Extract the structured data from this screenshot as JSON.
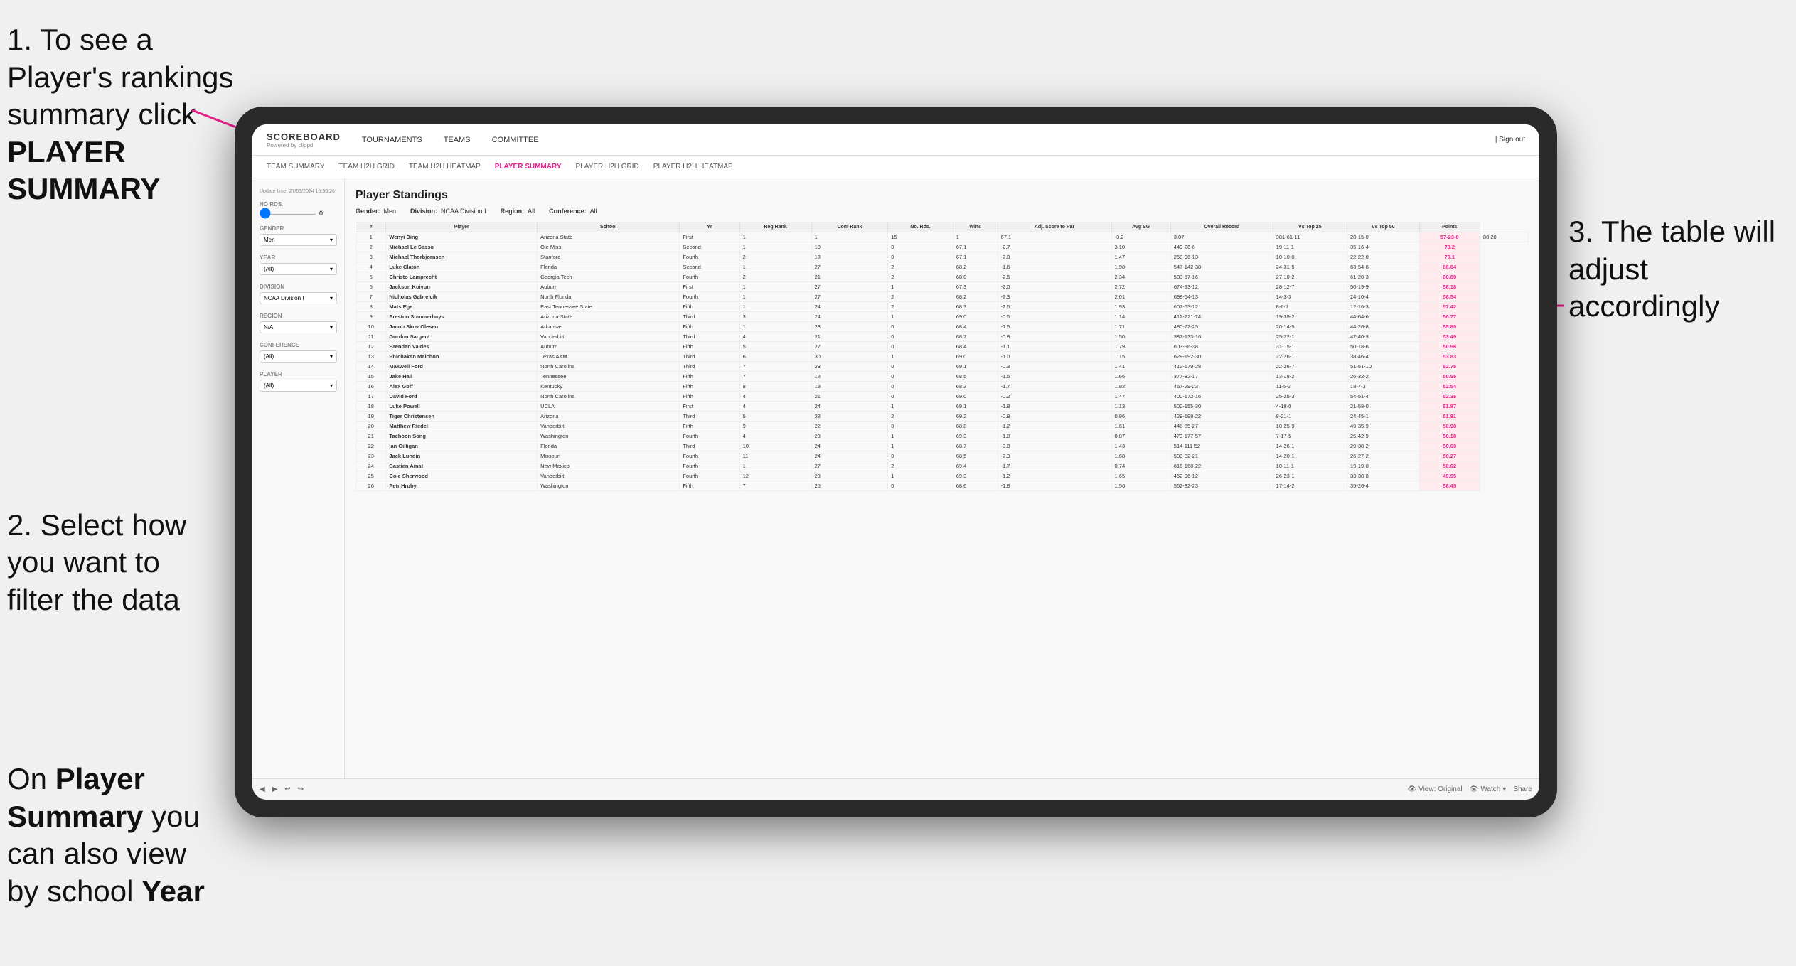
{
  "annotations": {
    "step1": "1. To see a Player's rankings summary click ",
    "step1_bold": "PLAYER SUMMARY",
    "step2_line1": "2. Select how",
    "step2_line2": "you want to",
    "step2_line3": "filter the data",
    "step3_left_line1": "On ",
    "step3_left_bold1": "Player",
    "step3_left_line2": "Summary",
    "step3_left_normal": " you",
    "step3_left_line3": "can also view",
    "step3_left_line4": "by school ",
    "step3_left_bold2": "Year",
    "step3_right_line1": "3. The table will",
    "step3_right_line2": "adjust accordingly"
  },
  "navbar": {
    "logo": "SCOREBOARD",
    "logo_sub": "Powered by clippd",
    "links": [
      "TOURNAMENTS",
      "TEAMS",
      "COMMITTEE"
    ],
    "right": [
      "| Sign out"
    ]
  },
  "sub_navbar": {
    "links": [
      "TEAM SUMMARY",
      "TEAM H2H GRID",
      "TEAM H2H HEATMAP",
      "PLAYER SUMMARY",
      "PLAYER H2H GRID",
      "PLAYER H2H HEATMAP"
    ]
  },
  "sidebar": {
    "update_time": "Update time: 27/03/2024 16:56:26",
    "no_rds_label": "No Rds.",
    "gender_label": "Gender",
    "gender_value": "Men",
    "year_label": "Year",
    "year_value": "(All)",
    "division_label": "Division",
    "division_value": "NCAA Division I",
    "region_label": "Region",
    "region_value": "N/A",
    "conference_label": "Conference",
    "conference_value": "(All)",
    "player_label": "Player",
    "player_value": "(All)"
  },
  "main": {
    "title": "Player Standings",
    "filters": {
      "gender_label": "Gender:",
      "gender_value": "Men",
      "division_label": "Division:",
      "division_value": "NCAA Division I",
      "region_label": "Region:",
      "region_value": "All",
      "conference_label": "Conference:",
      "conference_value": "All"
    },
    "table": {
      "headers": [
        "#",
        "Player",
        "School",
        "Yr",
        "Reg Rank",
        "Conf Rank",
        "No. Rds.",
        "Wins",
        "Adj. Score to Par",
        "Avg SG",
        "Overall Record",
        "Vs Top 25",
        "Vs Top 50",
        "Points"
      ],
      "rows": [
        [
          "1",
          "Wenyi Ding",
          "Arizona State",
          "First",
          "1",
          "1",
          "15",
          "1",
          "67.1",
          "-3.2",
          "3.07",
          "381-61-11",
          "28-15-0",
          "57-23-0",
          "88.20"
        ],
        [
          "2",
          "Michael Le Sasso",
          "Ole Miss",
          "Second",
          "1",
          "18",
          "0",
          "67.1",
          "-2.7",
          "3.10",
          "440-26-6",
          "19-11-1",
          "35-16-4",
          "78.2"
        ],
        [
          "3",
          "Michael Thorbjornsen",
          "Stanford",
          "Fourth",
          "2",
          "18",
          "0",
          "67.1",
          "-2.0",
          "1.47",
          "258-96-13",
          "10-10-0",
          "22-22-0",
          "70.1"
        ],
        [
          "4",
          "Luke Claton",
          "Florida",
          "Second",
          "1",
          "27",
          "2",
          "68.2",
          "-1.6",
          "1.98",
          "547-142-38",
          "24-31-5",
          "63-54-6",
          "66.04"
        ],
        [
          "5",
          "Christo Lamprecht",
          "Georgia Tech",
          "Fourth",
          "2",
          "21",
          "2",
          "68.0",
          "-2.5",
          "2.34",
          "533-57-16",
          "27-10-2",
          "61-20-3",
          "60.89"
        ],
        [
          "6",
          "Jackson Koivun",
          "Auburn",
          "First",
          "1",
          "27",
          "1",
          "67.3",
          "-2.0",
          "2.72",
          "674-33-12",
          "28-12-7",
          "50-19-9",
          "58.18"
        ],
        [
          "7",
          "Nicholas Gabrelcik",
          "North Florida",
          "Fourth",
          "1",
          "27",
          "2",
          "68.2",
          "-2.3",
          "2.01",
          "698-54-13",
          "14-3-3",
          "24-10-4",
          "58.54"
        ],
        [
          "8",
          "Mats Ege",
          "East Tennessee State",
          "Fifth",
          "1",
          "24",
          "2",
          "68.3",
          "-2.5",
          "1.93",
          "607-63-12",
          "8-6-1",
          "12-16-3",
          "57.42"
        ],
        [
          "9",
          "Preston Summerhays",
          "Arizona State",
          "Third",
          "3",
          "24",
          "1",
          "69.0",
          "-0.5",
          "1.14",
          "412-221-24",
          "19-39-2",
          "44-64-6",
          "56.77"
        ],
        [
          "10",
          "Jacob Skov Olesen",
          "Arkansas",
          "Fifth",
          "1",
          "23",
          "0",
          "68.4",
          "-1.5",
          "1.71",
          "480-72-25",
          "20-14-5",
          "44-26-8",
          "55.80"
        ],
        [
          "11",
          "Gordon Sargent",
          "Vanderbilt",
          "Third",
          "4",
          "21",
          "0",
          "68.7",
          "-0.8",
          "1.50",
          "387-133-16",
          "25-22-1",
          "47-40-3",
          "53.49"
        ],
        [
          "12",
          "Brendan Valdes",
          "Auburn",
          "Fifth",
          "5",
          "27",
          "0",
          "68.4",
          "-1.1",
          "1.79",
          "603-96-38",
          "31-15-1",
          "50-18-6",
          "50.96"
        ],
        [
          "13",
          "Phichaksn Maichon",
          "Texas A&M",
          "Third",
          "6",
          "30",
          "1",
          "69.0",
          "-1.0",
          "1.15",
          "628-192-30",
          "22-26-1",
          "38-46-4",
          "53.83"
        ],
        [
          "14",
          "Maxwell Ford",
          "North Carolina",
          "Third",
          "7",
          "23",
          "0",
          "69.1",
          "-0.3",
          "1.41",
          "412-179-28",
          "22-26-7",
          "51-51-10",
          "52.75"
        ],
        [
          "15",
          "Jake Hall",
          "Tennessee",
          "Fifth",
          "7",
          "18",
          "0",
          "68.5",
          "-1.5",
          "1.66",
          "377-82-17",
          "13-18-2",
          "26-32-2",
          "50.55"
        ],
        [
          "16",
          "Alex Goff",
          "Kentucky",
          "Fifth",
          "8",
          "19",
          "0",
          "68.3",
          "-1.7",
          "1.92",
          "467-29-23",
          "11-5-3",
          "18-7-3",
          "52.54"
        ],
        [
          "17",
          "David Ford",
          "North Carolina",
          "Fifth",
          "4",
          "21",
          "0",
          "69.0",
          "-0.2",
          "1.47",
          "400-172-16",
          "25-25-3",
          "54-51-4",
          "52.35"
        ],
        [
          "18",
          "Luke Powell",
          "UCLA",
          "First",
          "4",
          "24",
          "1",
          "69.1",
          "-1.8",
          "1.13",
          "500-155-30",
          "4-18-0",
          "21-58-0",
          "51.87"
        ],
        [
          "19",
          "Tiger Christensen",
          "Arizona",
          "Third",
          "5",
          "23",
          "2",
          "69.2",
          "-0.8",
          "0.96",
          "429-198-22",
          "8-21-1",
          "24-45-1",
          "51.81"
        ],
        [
          "20",
          "Matthew Riedel",
          "Vanderbilt",
          "Fifth",
          "9",
          "22",
          "0",
          "68.8",
          "-1.2",
          "1.61",
          "448-85-27",
          "10-25-9",
          "49-35-9",
          "50.98"
        ],
        [
          "21",
          "Taehoon Song",
          "Washington",
          "Fourth",
          "4",
          "23",
          "1",
          "69.3",
          "-1.0",
          "0.87",
          "473-177-57",
          "7-17-5",
          "25-42-9",
          "50.18"
        ],
        [
          "22",
          "Ian Gilligan",
          "Florida",
          "Third",
          "10",
          "24",
          "1",
          "68.7",
          "-0.8",
          "1.43",
          "514-111-52",
          "14-26-1",
          "29-38-2",
          "50.69"
        ],
        [
          "23",
          "Jack Lundin",
          "Missouri",
          "Fourth",
          "11",
          "24",
          "0",
          "68.5",
          "-2.3",
          "1.68",
          "509-82-21",
          "14-20-1",
          "26-27-2",
          "50.27"
        ],
        [
          "24",
          "Bastien Amat",
          "New Mexico",
          "Fourth",
          "1",
          "27",
          "2",
          "69.4",
          "-1.7",
          "0.74",
          "616-168-22",
          "10-11-1",
          "19-19-0",
          "50.02"
        ],
        [
          "25",
          "Cole Sherwood",
          "Vanderbilt",
          "Fourth",
          "12",
          "23",
          "1",
          "69.3",
          "-1.2",
          "1.65",
          "452-96-12",
          "26-23-1",
          "33-38-8",
          "49.95"
        ],
        [
          "26",
          "Petr Hruby",
          "Washington",
          "Fifth",
          "7",
          "25",
          "0",
          "68.6",
          "-1.8",
          "1.56",
          "562-82-23",
          "17-14-2",
          "35-26-4",
          "58.45"
        ]
      ]
    },
    "toolbar": {
      "back": "◀",
      "forward": "▶",
      "view_label": "View: Original",
      "watch_label": "Watch",
      "share_label": "Share"
    }
  }
}
